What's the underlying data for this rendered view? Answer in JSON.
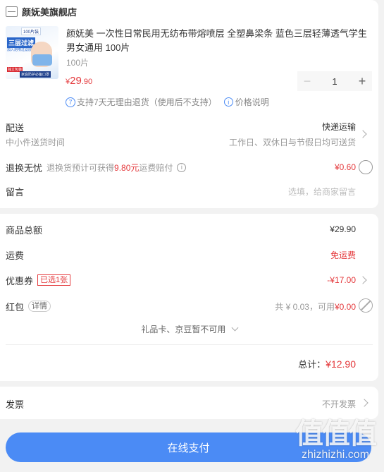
{
  "store": {
    "name": "颜妩美旗舰店",
    "icon": "store-icon"
  },
  "product": {
    "title": "颜妩美 一次性日常民用无纺布带熔喷层 全塑鼻梁条 蓝色三层轻薄透气学生男女通用 100片",
    "spec": "100片",
    "price_symbol": "¥",
    "price_int": "29",
    "price_dec": ".90",
    "quantity": "1",
    "thumb": {
      "badge": "100片装",
      "headline": "三层过滤",
      "sub": "加入熔喷过滤层",
      "tag": "独立包装",
      "foot": "家庭防护必备口罩"
    },
    "support_text": "支持7天无理由退货（使用后不支持）",
    "support_badge": "7",
    "price_note": "价格说明"
  },
  "delivery": {
    "label": "配送",
    "method": "快递运输",
    "sub_left": "中小件送货时间",
    "sub_right": "工作日、双休日与节假日均可送货"
  },
  "return_worry": {
    "label": "退换无忧",
    "desc_prefix": "退换货预计可获得",
    "desc_amount": "9.80元",
    "desc_suffix": "运费赔付",
    "price": "¥0.60"
  },
  "message": {
    "label": "留言",
    "placeholder": "选填，给商家留言"
  },
  "summary": {
    "goods_label": "商品总额",
    "goods_value": "¥29.90",
    "freight_label": "运费",
    "freight_value": "免运费",
    "coupon_label": "优惠券",
    "coupon_badge": "已选1张",
    "coupon_value": "-¥17.00",
    "redpack_label": "红包",
    "redpack_detail": "详情",
    "redpack_info": "共 ¥ 0.03，可用",
    "redpack_value": "¥0.00",
    "gift_text": "礼品卡、京豆暂不可用",
    "total_label": "总计：",
    "total_value": "¥12.90"
  },
  "invoice": {
    "label": "发票",
    "value": "不开发票"
  },
  "pay_button": "在线支付",
  "watermark": {
    "text": "值值值",
    "url": "zhizhizhi.com"
  },
  "colors": {
    "accent": "#e4393c",
    "pay": "#4b8bf5"
  }
}
